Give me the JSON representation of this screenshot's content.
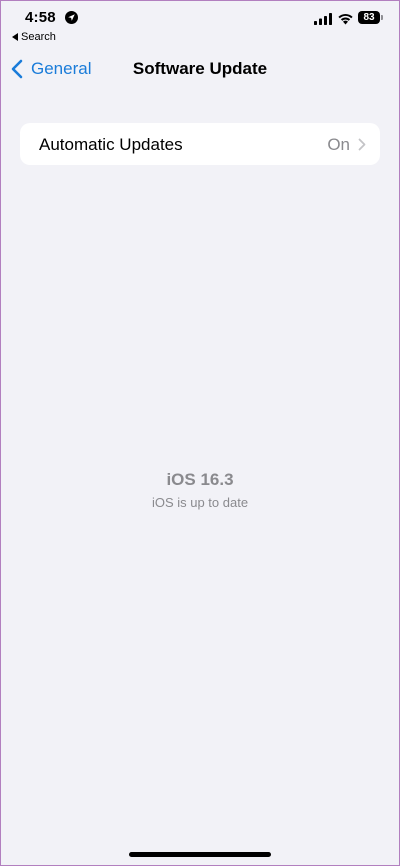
{
  "status_bar": {
    "time": "4:58",
    "back_app": "Search",
    "battery": "83"
  },
  "nav": {
    "back_label": "General",
    "title": "Software Update"
  },
  "settings": {
    "automatic_updates": {
      "label": "Automatic Updates",
      "value": "On"
    }
  },
  "status": {
    "version": "iOS 16.3",
    "message": "iOS is up to date"
  },
  "colors": {
    "accent": "#1a7cd9",
    "background": "#f2f2f7",
    "secondary_text": "#8a8a8e"
  },
  "icons": [
    "location-icon",
    "cellular-signal-icon",
    "wifi-icon",
    "battery-icon",
    "chevron-left-icon",
    "chevron-right-icon"
  ]
}
